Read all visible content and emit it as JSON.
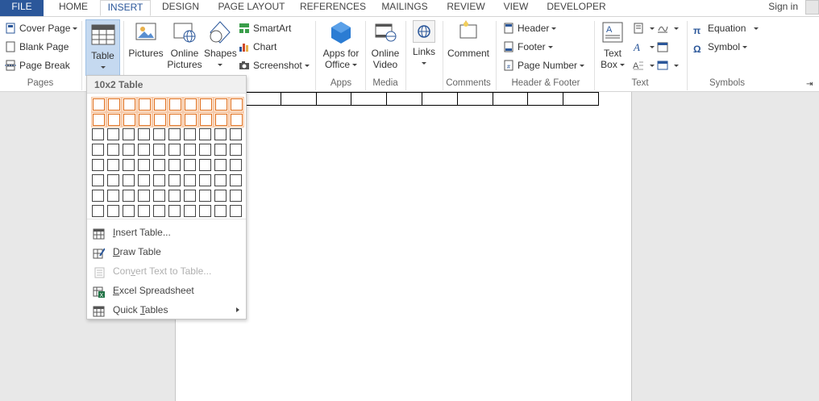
{
  "tabs": [
    "FILE",
    "HOME",
    "INSERT",
    "DESIGN",
    "PAGE LAYOUT",
    "REFERENCES",
    "MAILINGS",
    "REVIEW",
    "VIEW",
    "DEVELOPER"
  ],
  "signin": "Sign in",
  "ribbon": {
    "pages": {
      "label": "Pages",
      "items": [
        "Cover Page",
        "Blank Page",
        "Page Break"
      ]
    },
    "tables": {
      "table": "Table"
    },
    "illustrations": {
      "pictures": "Pictures",
      "online_pictures_1": "Online",
      "online_pictures_2": "Pictures",
      "shapes": "Shapes",
      "smartart": "SmartArt",
      "chart": "Chart",
      "screenshot": "Screenshot"
    },
    "apps": {
      "label": "Apps",
      "apps_1": "Apps for",
      "apps_2": "Office"
    },
    "media": {
      "label": "Media",
      "video_1": "Online",
      "video_2": "Video"
    },
    "links": {
      "links": "Links"
    },
    "comments": {
      "label": "Comments",
      "comment": "Comment"
    },
    "header_footer": {
      "label": "Header & Footer",
      "header": "Header",
      "footer": "Footer",
      "page_number": "Page Number"
    },
    "text": {
      "label": "Text",
      "textbox_1": "Text",
      "textbox_2": "Box"
    },
    "symbols": {
      "label": "Symbols",
      "equation": "Equation",
      "symbol": "Symbol"
    }
  },
  "dropdown": {
    "title": "10x2 Table",
    "grid_cols": 10,
    "grid_rows": 8,
    "selected_cols": 10,
    "selected_rows": 2,
    "menu": [
      {
        "prefix": "",
        "key": "I",
        "rest": "nsert Table...",
        "disabled": false,
        "icon": "insert-table-icon"
      },
      {
        "prefix": "",
        "key": "D",
        "rest": "raw Table",
        "disabled": false,
        "icon": "draw-table-icon"
      },
      {
        "prefix": "Con",
        "key": "v",
        "rest": "ert Text to Table...",
        "disabled": true,
        "icon": "convert-text-icon"
      },
      {
        "prefix": "",
        "key": "E",
        "rest": "xcel Spreadsheet",
        "disabled": false,
        "icon": "excel-spreadsheet-icon"
      },
      {
        "prefix": "Quick ",
        "key": "T",
        "rest": "ables",
        "disabled": false,
        "icon": "quick-tables-icon"
      }
    ]
  },
  "colors": {
    "accent": "#2b579a",
    "selection_border": "#e07020",
    "selection_fill": "#fdebd9"
  }
}
